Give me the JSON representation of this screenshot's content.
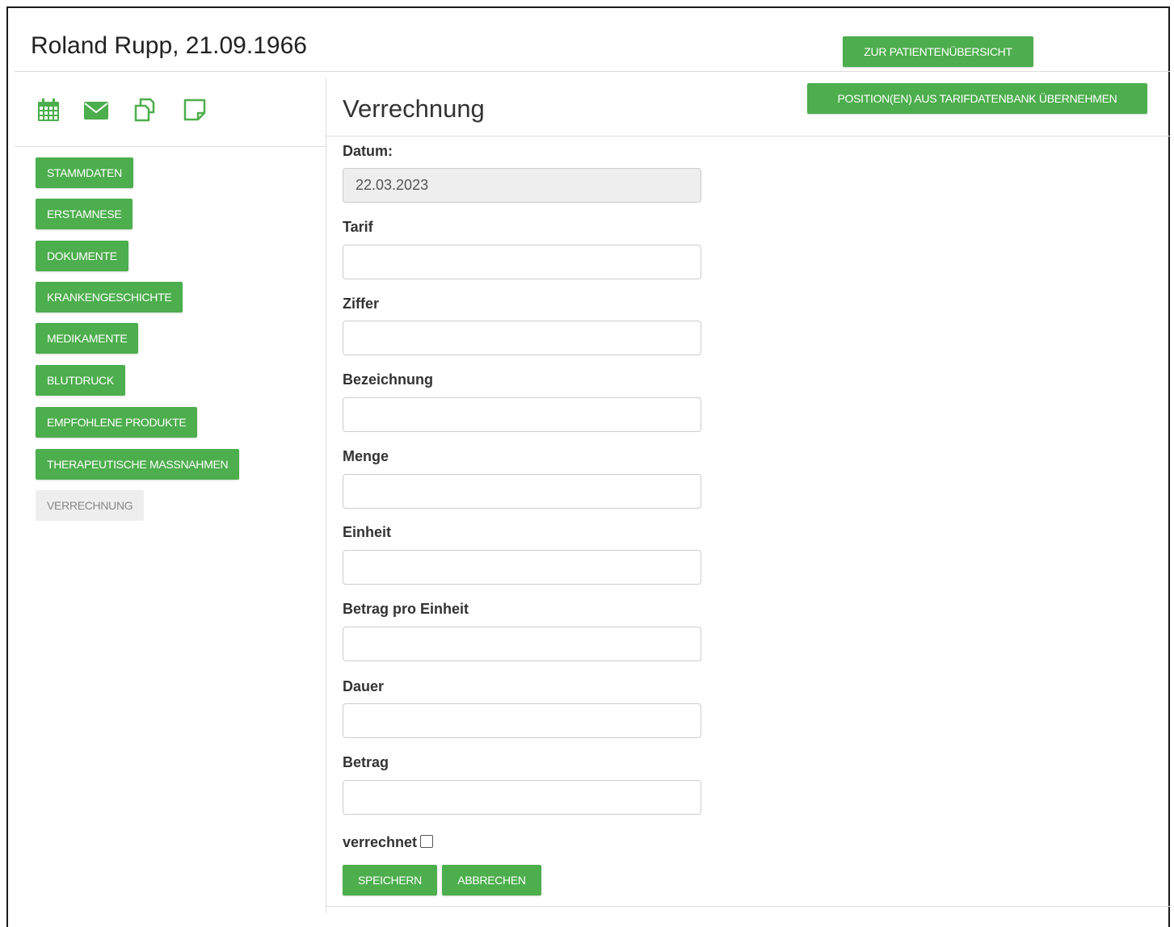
{
  "header": {
    "patient_name": "Roland Rupp, 21.09.1966",
    "overview_button": "ZUR PATIENTENÜBERSICHT",
    "import_button": "POSITION(EN) AUS TARIFDATENBANK ÜBERNEHMEN"
  },
  "toolbar_icons": [
    "calendar-icon",
    "envelope-icon",
    "copy-icon",
    "note-icon"
  ],
  "sidebar": {
    "items": [
      {
        "label": "STAMMDATEN",
        "active": true
      },
      {
        "label": "ERSTAMNESE",
        "active": true
      },
      {
        "label": "DOKUMENTE",
        "active": true
      },
      {
        "label": "KRANKENGESCHICHTE",
        "active": true
      },
      {
        "label": "MEDIKAMENTE",
        "active": true
      },
      {
        "label": "BLUTDRUCK",
        "active": true
      },
      {
        "label": "EMPFOHLENE PRODUKTE",
        "active": true
      },
      {
        "label": "THERAPEUTISCHE MASSNAHMEN",
        "active": true
      },
      {
        "label": "VERRECHNUNG",
        "active": false
      }
    ]
  },
  "main": {
    "title": "Verrechnung",
    "fields": {
      "datum": {
        "label": "Datum:",
        "value": "22.03.2023"
      },
      "tarif": {
        "label": "Tarif",
        "value": ""
      },
      "ziffer": {
        "label": "Ziffer",
        "value": ""
      },
      "bezeichnung": {
        "label": "Bezeichnung",
        "value": ""
      },
      "menge": {
        "label": "Menge",
        "value": ""
      },
      "einheit": {
        "label": "Einheit",
        "value": ""
      },
      "betrag_pro_einheit": {
        "label": "Betrag pro Einheit",
        "value": ""
      },
      "dauer": {
        "label": "Dauer",
        "value": ""
      },
      "betrag": {
        "label": "Betrag",
        "value": ""
      }
    },
    "verrechnet_label": "verrechnet",
    "verrechnet_checked": false,
    "save_button": "SPEICHERN",
    "cancel_button": "ABBRECHEN"
  },
  "colors": {
    "accent_green": "#4cae4c",
    "inactive_bg": "#eeeeee"
  }
}
